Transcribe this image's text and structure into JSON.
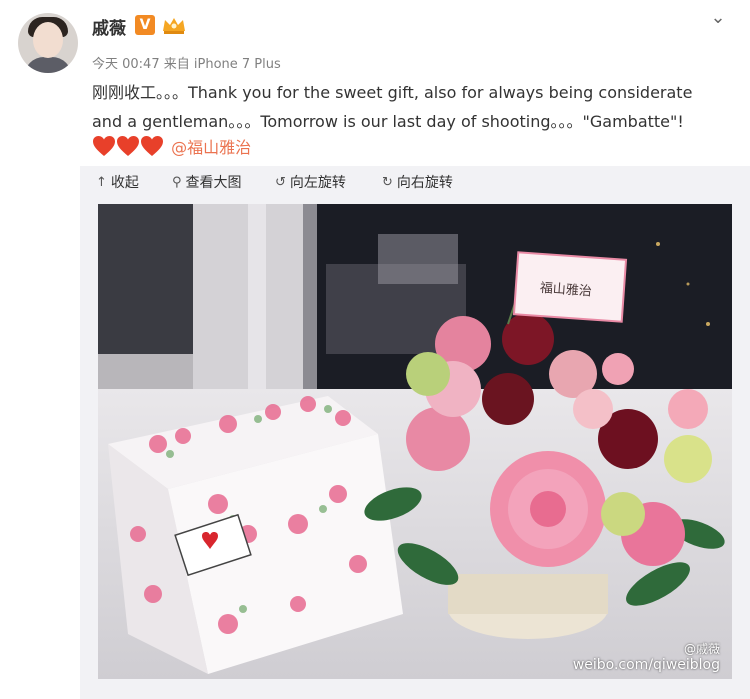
{
  "post": {
    "username": "戚薇",
    "verified_badge": "V",
    "time": "今天 00:47",
    "source": "来自 iPhone 7 Plus",
    "text_lines": [
      "刚刚收工。。。Thank you for the sweet gift, also for always being considerate",
      "and a gentleman。。。Tomorrow is our last day of shooting。。。\"Gambatte\"!"
    ],
    "mention": "@福山雅治",
    "heart_count": 3,
    "colors": {
      "verified": "#f28a23",
      "mention": "#eb7350",
      "heart": "#e8402a"
    }
  },
  "toolbar": {
    "collapse": "收起",
    "view_large": "查看大图",
    "rotate_left": "向左旋转",
    "rotate_right": "向右旋转"
  },
  "photo": {
    "card_text": "福山雅治",
    "watermark_name": "@戚薇",
    "watermark_site": "weibo.com/qiweiblog"
  }
}
